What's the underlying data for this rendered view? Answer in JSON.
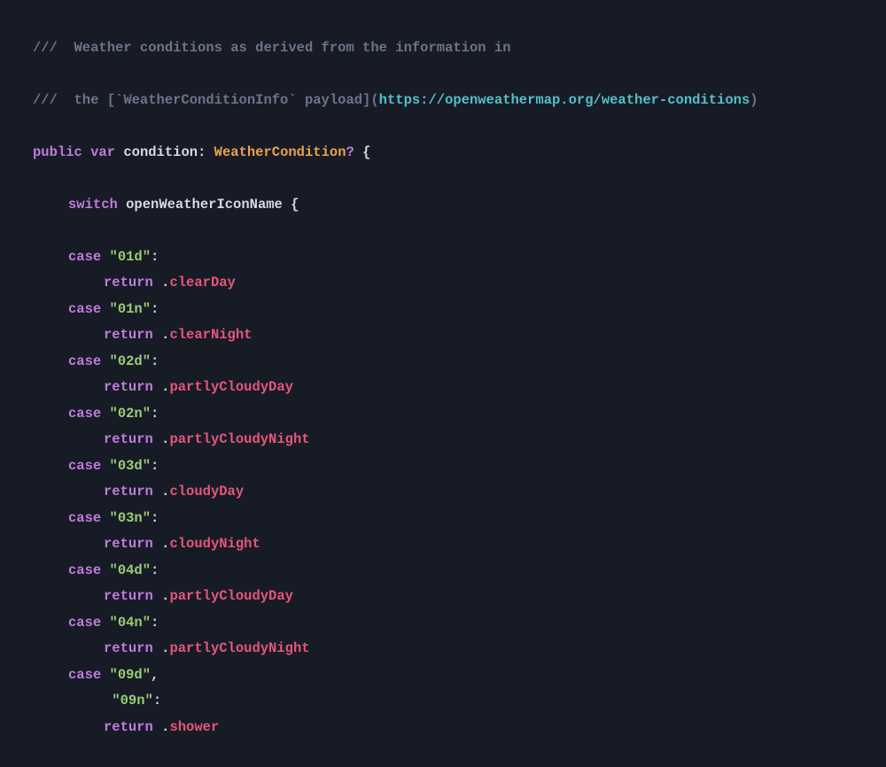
{
  "code": {
    "comment_lines": [
      {
        "slashes": "///",
        "before_link": "  Weather conditions as derived from the information in",
        "link": ""
      },
      {
        "slashes": "///",
        "before_link": "  the [`WeatherConditionInfo` payload](",
        "link": "https://openweathermap.org/weather-conditions",
        "after_link": ")"
      }
    ],
    "decl": {
      "kw_public": "public",
      "kw_var": "var",
      "name": "condition",
      "colon": ": ",
      "type": "WeatherCondition",
      "opt": "?",
      "brace": " {"
    },
    "switch": {
      "kw": "switch",
      "expr": "openWeatherIconName",
      "brace": " {"
    },
    "cases": [
      {
        "labels": [
          "\"01d\""
        ],
        "return_member": "clearDay"
      },
      {
        "labels": [
          "\"01n\""
        ],
        "return_member": "clearNight"
      },
      {
        "labels": [
          "\"02d\""
        ],
        "return_member": "partlyCloudyDay"
      },
      {
        "labels": [
          "\"02n\""
        ],
        "return_member": "partlyCloudyNight"
      },
      {
        "labels": [
          "\"03d\""
        ],
        "return_member": "cloudyDay"
      },
      {
        "labels": [
          "\"03n\""
        ],
        "return_member": "cloudyNight"
      },
      {
        "labels": [
          "\"04d\""
        ],
        "return_member": "partlyCloudyDay"
      },
      {
        "labels": [
          "\"04n\""
        ],
        "return_member": "partlyCloudyNight"
      },
      {
        "labels": [
          "\"09d\"",
          "\"09n\""
        ],
        "return_member": "shower"
      }
    ],
    "kw_case": "case",
    "kw_return": "return",
    "dot": "."
  }
}
